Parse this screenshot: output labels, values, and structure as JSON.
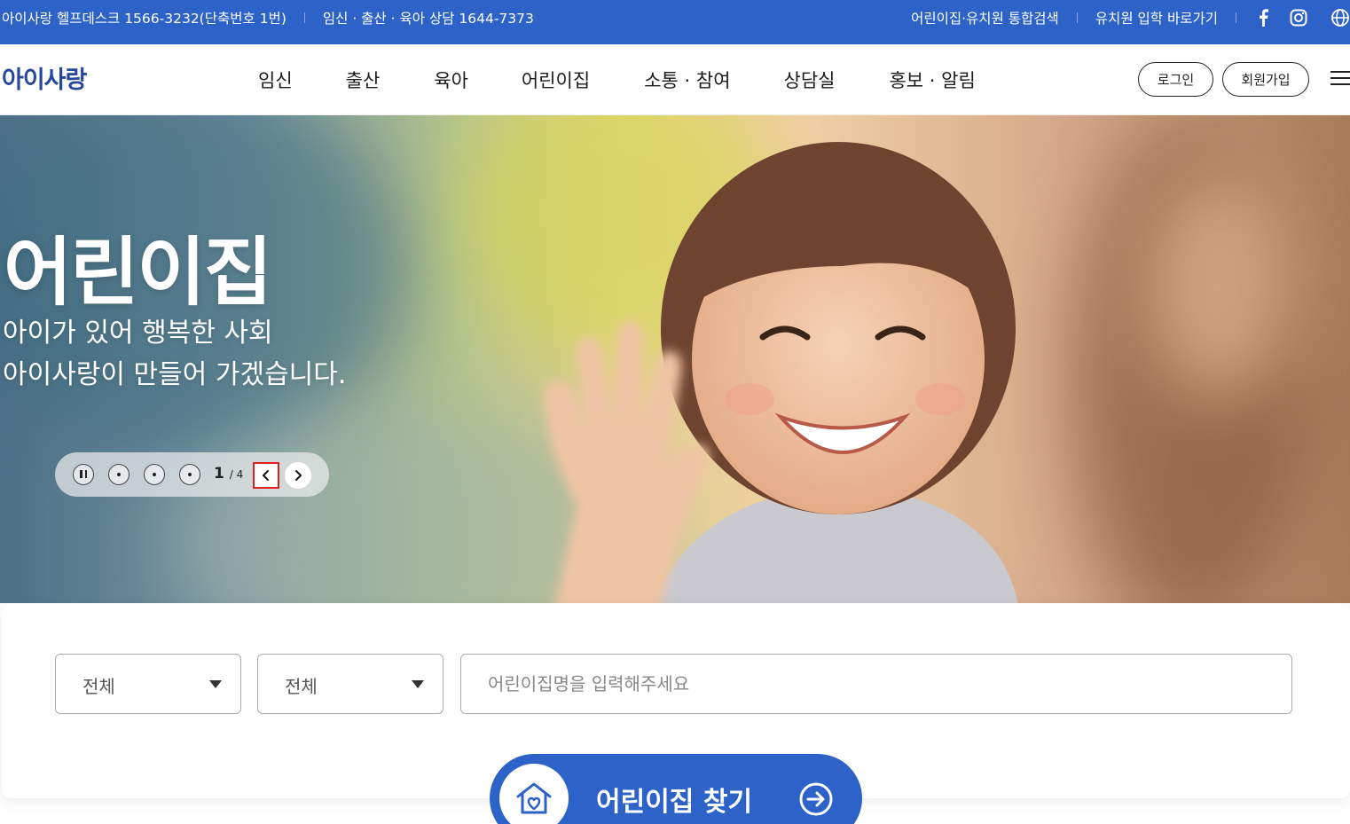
{
  "topbar": {
    "helpdesk": "아이사랑 헬프데스크 1566-3232(단축번호 1번)",
    "counsel": "임신 · 출산 · 육아 상담 1644-7373",
    "integrated_search": "어린이집·유치원 통합검색",
    "kinder_link": "유치원 입학 바로가기",
    "sns": [
      "facebook-icon",
      "instagram-icon",
      "globe-icon"
    ]
  },
  "header": {
    "logo": "아이사랑",
    "nav": [
      "임신",
      "출산",
      "육아",
      "어린이집",
      "소통 · 참여",
      "상담실",
      "홍보 · 알림"
    ],
    "login": "로그인",
    "signup": "회원가입"
  },
  "hero": {
    "title": "어린이집",
    "subtitle_line1": "아이가 있어 행복한 사회",
    "subtitle_line2": "아이사랑이 만들어 가겠습니다.",
    "slide_current": "1",
    "slide_total": "/ 4"
  },
  "search": {
    "select1": "전체",
    "select2": "전체",
    "placeholder": "어린이집명을 입력해주세요",
    "button": "어린이집 찾기"
  },
  "colors": {
    "brand_blue": "#2d63c8",
    "logo_navy": "#27489a",
    "focus_red": "#e02020"
  }
}
